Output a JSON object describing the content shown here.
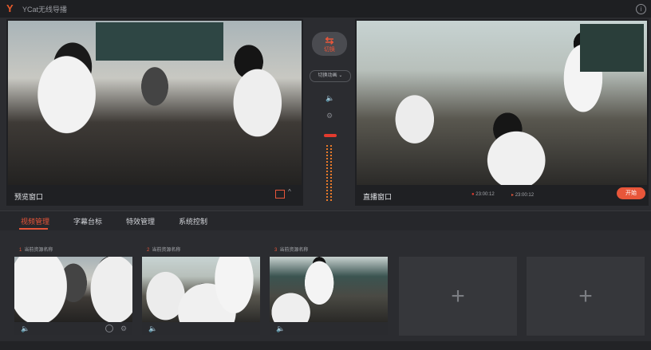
{
  "app": {
    "title": "YCat无线导播",
    "logo_letter": "Y"
  },
  "preview": {
    "label": "预览窗口"
  },
  "live": {
    "label": "直播窗口",
    "rec_time": "23:00:12",
    "live_time": "23:00:12",
    "start_label": "开始"
  },
  "controls": {
    "switch_label": "切换",
    "switch_arrow": "⇆",
    "transition_select": "切换动画"
  },
  "tabs": [
    {
      "label": "视频管理",
      "active": true
    },
    {
      "label": "字幕台标",
      "active": false
    },
    {
      "label": "特效管理",
      "active": false
    },
    {
      "label": "系统控制",
      "active": false
    }
  ],
  "sources": [
    {
      "index": "1",
      "name": "当前资源名称"
    },
    {
      "index": "2",
      "name": "当前资源名称"
    },
    {
      "index": "3",
      "name": "当前资源名称"
    }
  ],
  "icons": {
    "plus": "+",
    "speaker": "🔈",
    "gear": "⚙",
    "info": "i",
    "chevron": "⌄"
  },
  "colors": {
    "accent": "#e8563a",
    "background": "#2b2c30"
  }
}
